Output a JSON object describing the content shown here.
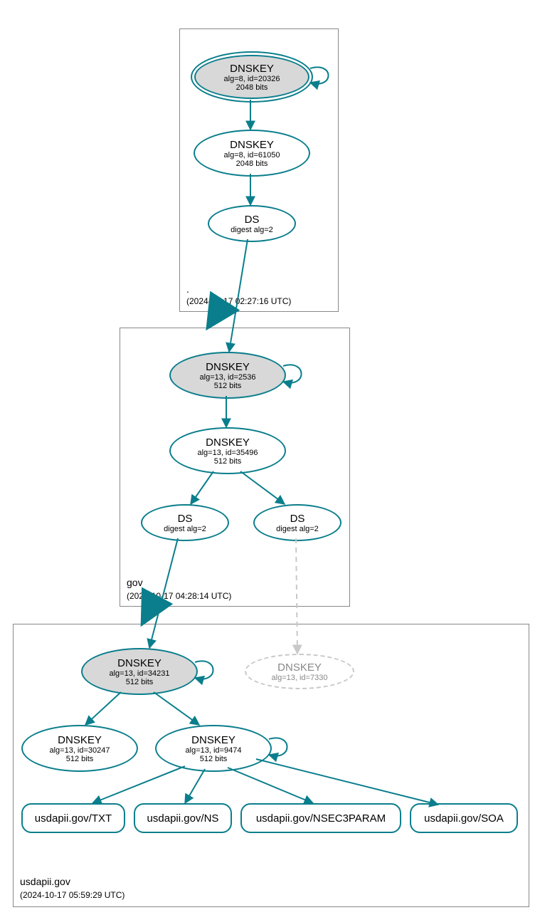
{
  "chart_data": {
    "type": "dnssec-chain",
    "zones": [
      {
        "name": ".",
        "timestamp": "(2024-10-17 02:27:16 UTC)",
        "nodes": [
          {
            "id": "root-ksk",
            "type": "DNSKEY",
            "alg": "alg=8, id=20326",
            "bits": "2048 bits",
            "ksk": true,
            "selfsig": true
          },
          {
            "id": "root-zsk",
            "type": "DNSKEY",
            "alg": "alg=8, id=61050",
            "bits": "2048 bits"
          },
          {
            "id": "root-ds",
            "type": "DS",
            "alg": "digest alg=2"
          }
        ],
        "edges": [
          [
            "root-ksk",
            "root-ksk"
          ],
          [
            "root-ksk",
            "root-zsk"
          ],
          [
            "root-zsk",
            "root-ds"
          ]
        ]
      },
      {
        "name": "gov",
        "timestamp": "(2024-10-17 04:28:14 UTC)",
        "nodes": [
          {
            "id": "gov-ksk",
            "type": "DNSKEY",
            "alg": "alg=13, id=2536",
            "bits": "512 bits",
            "ksk": true,
            "selfsig": true
          },
          {
            "id": "gov-zsk",
            "type": "DNSKEY",
            "alg": "alg=13, id=35496",
            "bits": "512 bits"
          },
          {
            "id": "gov-ds1",
            "type": "DS",
            "alg": "digest alg=2"
          },
          {
            "id": "gov-ds2",
            "type": "DS",
            "alg": "digest alg=2"
          }
        ],
        "edges": [
          [
            "root-ds",
            "gov-ksk"
          ],
          [
            "gov-ksk",
            "gov-ksk"
          ],
          [
            "gov-ksk",
            "gov-zsk"
          ],
          [
            "gov-zsk",
            "gov-ds1"
          ],
          [
            "gov-zsk",
            "gov-ds2"
          ]
        ]
      },
      {
        "name": "usdapii.gov",
        "timestamp": "(2024-10-17 05:59:29 UTC)",
        "nodes": [
          {
            "id": "u-ksk",
            "type": "DNSKEY",
            "alg": "alg=13, id=34231",
            "bits": "512 bits",
            "ksk": true,
            "selfsig": true
          },
          {
            "id": "u-ghost",
            "type": "DNSKEY",
            "alg": "alg=13, id=7330",
            "ghost": true
          },
          {
            "id": "u-zsk1",
            "type": "DNSKEY",
            "alg": "alg=13, id=30247",
            "bits": "512 bits"
          },
          {
            "id": "u-zsk2",
            "type": "DNSKEY",
            "alg": "alg=13, id=9474",
            "bits": "512 bits",
            "selfsig": true
          }
        ],
        "rrsets": [
          "usdapii.gov/TXT",
          "usdapii.gov/NS",
          "usdapii.gov/NSEC3PARAM",
          "usdapii.gov/SOA"
        ],
        "edges": [
          [
            "gov-ds1",
            "u-ksk"
          ],
          [
            "gov-ds2",
            "u-ghost",
            "dashed"
          ],
          [
            "u-ksk",
            "u-ksk"
          ],
          [
            "u-ksk",
            "u-zsk1"
          ],
          [
            "u-ksk",
            "u-zsk2"
          ],
          [
            "u-zsk2",
            "u-zsk2"
          ],
          [
            "u-zsk2",
            "TXT"
          ],
          [
            "u-zsk2",
            "NS"
          ],
          [
            "u-zsk2",
            "NSEC3PARAM"
          ],
          [
            "u-zsk2",
            "SOA"
          ]
        ]
      }
    ]
  },
  "zones": {
    "root": {
      "label": ".",
      "ts": "(2024-10-17 02:27:16 UTC)"
    },
    "gov": {
      "label": "gov",
      "ts": "(2024-10-17 04:28:14 UTC)"
    },
    "usd": {
      "label": "usdapii.gov",
      "ts": "(2024-10-17 05:59:29 UTC)"
    }
  },
  "nodes": {
    "rootKsk": {
      "t": "DNSKEY",
      "l1": "alg=8, id=20326",
      "l2": "2048 bits"
    },
    "rootZsk": {
      "t": "DNSKEY",
      "l1": "alg=8, id=61050",
      "l2": "2048 bits"
    },
    "rootDs": {
      "t": "DS",
      "l1": "digest alg=2"
    },
    "govKsk": {
      "t": "DNSKEY",
      "l1": "alg=13, id=2536",
      "l2": "512 bits"
    },
    "govZsk": {
      "t": "DNSKEY",
      "l1": "alg=13, id=35496",
      "l2": "512 bits"
    },
    "govDs1": {
      "t": "DS",
      "l1": "digest alg=2"
    },
    "govDs2": {
      "t": "DS",
      "l1": "digest alg=2"
    },
    "uKsk": {
      "t": "DNSKEY",
      "l1": "alg=13, id=34231",
      "l2": "512 bits"
    },
    "uGhost": {
      "t": "DNSKEY",
      "l1": "alg=13, id=7330"
    },
    "uZsk1": {
      "t": "DNSKEY",
      "l1": "alg=13, id=30247",
      "l2": "512 bits"
    },
    "uZsk2": {
      "t": "DNSKEY",
      "l1": "alg=13, id=9474",
      "l2": "512 bits"
    }
  },
  "rr": {
    "txt": "usdapii.gov/TXT",
    "ns": "usdapii.gov/NS",
    "nsec": "usdapii.gov/NSEC3PARAM",
    "soa": "usdapii.gov/SOA"
  }
}
